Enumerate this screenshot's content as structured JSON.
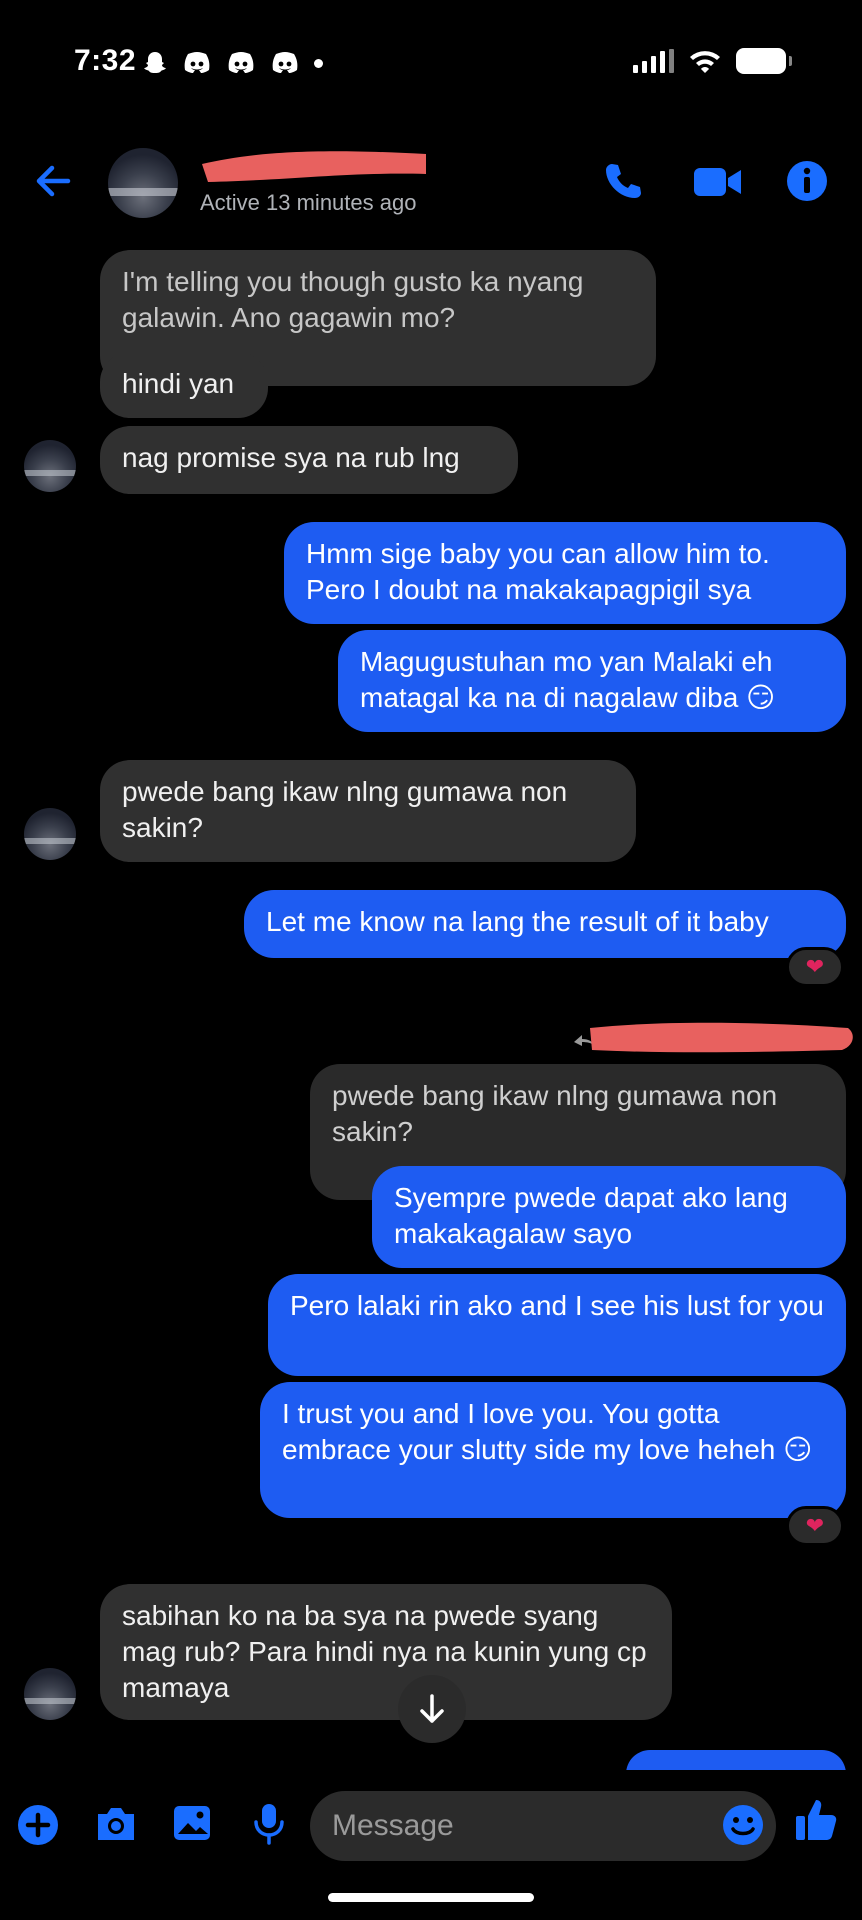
{
  "status_bar": {
    "time": "7:32",
    "left_icons": [
      "snapchat-icon",
      "discord-icon",
      "discord-icon",
      "discord-icon"
    ]
  },
  "header": {
    "active_status": "Active 13 minutes ago",
    "icons": [
      "back-arrow-icon",
      "phone-icon",
      "video-camera-icon",
      "info-icon"
    ]
  },
  "messages": [
    {
      "side": "in",
      "text": "I'm telling you though gusto ka nyang galawin. Ano gagawin mo?",
      "style": "reply-quote"
    },
    {
      "side": "in",
      "text": "hindi yan"
    },
    {
      "side": "in",
      "text": "nag promise sya na rub lng"
    },
    {
      "side": "out",
      "text": "Hmm sige baby you can allow him to. Pero I doubt na makakapagpigil sya"
    },
    {
      "side": "out",
      "text": "Magugustuhan mo yan Malaki eh matagal ka na di nagalaw diba 😏"
    },
    {
      "side": "in",
      "text": "pwede bang ikaw nlng gumawa non sakin?"
    },
    {
      "side": "out",
      "text": "Let me know na lang the result of it baby",
      "reaction": "❤"
    },
    {
      "side": "out",
      "text": "pwede bang ikaw nlng gumawa non sakin?",
      "style": "reply-quote"
    },
    {
      "side": "out",
      "text": "Syempre pwede dapat ako lang makakagalaw sayo"
    },
    {
      "side": "out",
      "text": "Pero lalaki rin ako and I see his lust for you"
    },
    {
      "side": "out",
      "text": "I trust you and I love you. You gotta embrace your slutty side my love heheh 😏",
      "reaction": "❤"
    },
    {
      "side": "in",
      "text": "sabihan ko na ba sya na pwede syang mag rub? Para hindi nya na kunin yung cp mamaya"
    }
  ],
  "composer": {
    "placeholder": "Message",
    "icons": [
      "plus-icon",
      "camera-icon",
      "gallery-icon",
      "microphone-icon",
      "emoji-icon",
      "thumbs-up-icon"
    ]
  },
  "colors": {
    "accent": "#1e5cf2",
    "icon_blue": "#1a6dff",
    "incoming_bubble": "#303030",
    "background": "#000000",
    "reaction_heart": "#e0245e"
  }
}
